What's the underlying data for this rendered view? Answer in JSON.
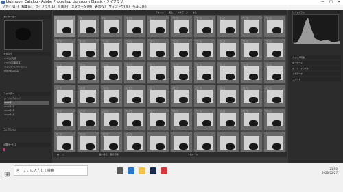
{
  "window": {
    "title": "Lightroom Catalog - Adobe Photoshop Lightroom Classic - ライブラリ",
    "controls": [
      "—",
      "□",
      "✕"
    ]
  },
  "menu": [
    "ファイル(F)",
    "編集(E)",
    "ライブラリ(L)",
    "写真(P)",
    "メタデータ(M)",
    "表示(V)",
    "ウィンドウ(W)",
    "ヘルプ(H)"
  ],
  "left_panel": {
    "navigator_label": "ナビゲーター",
    "catalog_label": "カタログ",
    "catalog_items": [
      "すべての写真",
      "すべての同期写真",
      "クイックコレクション +",
      "前回の読み込み"
    ],
    "folders_label": "フォルダー",
    "folder_items": [
      "ローカルディスク",
      "2020年",
      "2020年3月",
      "2020年4月",
      "2020年5月"
    ],
    "collections_label": "コレクション",
    "publish_label": "公開サービス"
  },
  "top_toolbar": {
    "items": [
      "テキスト",
      "属性",
      "メタデータ",
      "なし"
    ]
  },
  "grid": {
    "cell_numbers": [
      "7",
      "8",
      "9",
      "10",
      "11",
      "12",
      "13",
      "14",
      "15",
      "16",
      "17",
      "18",
      "19",
      "20",
      "21",
      "22",
      "23",
      "24",
      "25",
      "26",
      "27",
      "28",
      "29",
      "30",
      "31",
      "32",
      "33",
      "34",
      "35",
      "36",
      "37",
      "38",
      "39",
      "40",
      "41",
      "42",
      "43",
      "44",
      "45",
      "46",
      "47",
      "48",
      "49",
      "50",
      "51",
      "52",
      "53",
      "54",
      "55",
      "56",
      "57",
      "58",
      "59",
      "60"
    ]
  },
  "bottom_toolbar": {
    "sort_label": "並べ替え：",
    "sort_value": "撮影日時",
    "thumbnails_label": "サムネール"
  },
  "right_panel": {
    "histogram_label": "ヒストグラム",
    "quick_develop_label": "クイック現像",
    "keywording_label": "キーワード",
    "keyword_list_label": "キーワードリスト",
    "metadata_label": "メタデータ",
    "comments_label": "コメント"
  },
  "taskbar": {
    "search_placeholder": "ここに入力して検索",
    "time": "21:50",
    "date": "2020/02/27"
  },
  "colors": {
    "accent": "#3b6fb0",
    "grid_bg": "#3a3a3a",
    "cell_bg": "#6a6a6a",
    "pink_label": "#c43a7a"
  }
}
